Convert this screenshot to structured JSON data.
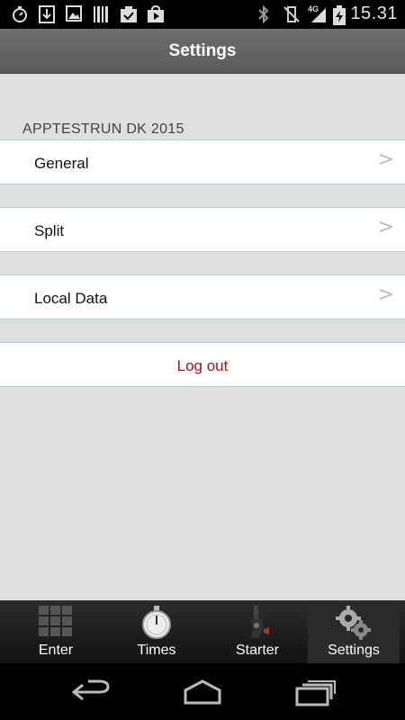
{
  "status_bar": {
    "time": "15.31",
    "network": "4G",
    "icons": [
      "stopwatch-icon",
      "download-icon",
      "image-icon",
      "barcode-icon",
      "clipboard-check-icon",
      "play-store-icon",
      "bluetooth-icon",
      "vibrate-off-icon",
      "signal-icon",
      "battery-charging-icon"
    ]
  },
  "action_bar": {
    "title": "Settings"
  },
  "settings": {
    "section_header": "APPTESTRUN DK 2015",
    "items": [
      {
        "label": "General",
        "chevron": ">"
      },
      {
        "label": "Split",
        "chevron": ">"
      },
      {
        "label": "Local Data",
        "chevron": ">"
      }
    ],
    "logout_label": "Log out",
    "logout_color": "#a31515"
  },
  "tabs": [
    {
      "label": "Enter",
      "icon": "grid-icon"
    },
    {
      "label": "Times",
      "icon": "stopwatch-icon"
    },
    {
      "label": "Starter",
      "icon": "starter-pistol-icon"
    },
    {
      "label": "Settings",
      "icon": "gears-icon",
      "active": true
    }
  ],
  "nav_bar": {
    "buttons": [
      "back-icon",
      "home-icon",
      "recents-icon"
    ]
  }
}
